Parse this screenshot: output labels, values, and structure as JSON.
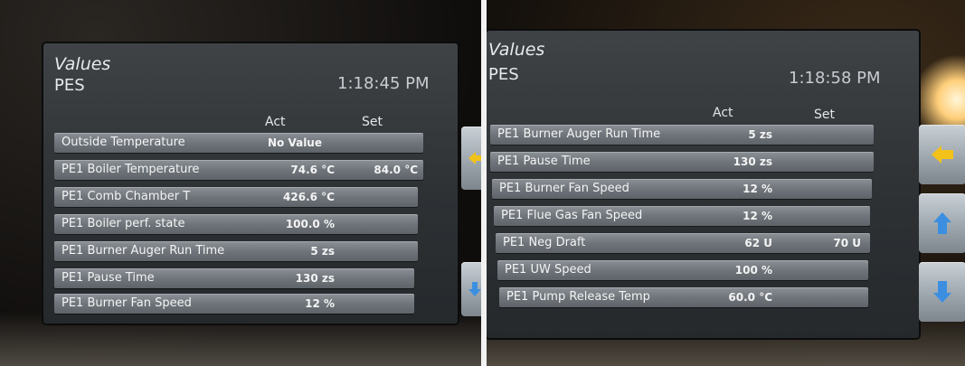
{
  "panels": [
    {
      "title": "Values",
      "subtitle": "PES",
      "time": "1:18:45 PM",
      "col_act": "Act",
      "col_set": "Set",
      "rows": [
        {
          "label": "Outside Temperature",
          "act": "No Value",
          "set": ""
        },
        {
          "label": "PE1 Boiler Temperature",
          "act": "74.6 °C",
          "set": "84.0 °C"
        },
        {
          "label": "PE1 Comb Chamber T",
          "act": "426.6 °C",
          "set": ""
        },
        {
          "label": "PE1 Boiler perf. state",
          "act": "100.0 %",
          "set": ""
        },
        {
          "label": "PE1 Burner Auger Run Time",
          "act": "5 zs",
          "set": ""
        },
        {
          "label": "PE1 Pause Time",
          "act": "130 zs",
          "set": ""
        },
        {
          "label": "PE1 Burner Fan Speed",
          "act": "12 %",
          "set": ""
        }
      ]
    },
    {
      "title": "Values",
      "subtitle": "PES",
      "time": "1:18:58 PM",
      "col_act": "Act",
      "col_set": "Set",
      "rows": [
        {
          "label": "PE1 Burner Auger Run Time",
          "act": "5 zs",
          "set": ""
        },
        {
          "label": "PE1 Pause Time",
          "act": "130 zs",
          "set": ""
        },
        {
          "label": "PE1 Burner Fan Speed",
          "act": "12 %",
          "set": ""
        },
        {
          "label": "PE1 Flue Gas Fan Speed",
          "act": "12 %",
          "set": ""
        },
        {
          "label": "PE1 Neg Draft",
          "act": "62 U",
          "set": "70 U"
        },
        {
          "label": "PE1 UW Speed",
          "act": "100 %",
          "set": ""
        },
        {
          "label": "PE1 Pump Release Temp",
          "act": "60.0 °C",
          "set": ""
        }
      ]
    }
  ],
  "icons": {
    "back": "arrow-left-icon",
    "up": "arrow-up-icon",
    "down": "arrow-down-icon"
  },
  "colors": {
    "arrow_yellow": "#f2c21a",
    "arrow_blue": "#3c8fe0"
  }
}
